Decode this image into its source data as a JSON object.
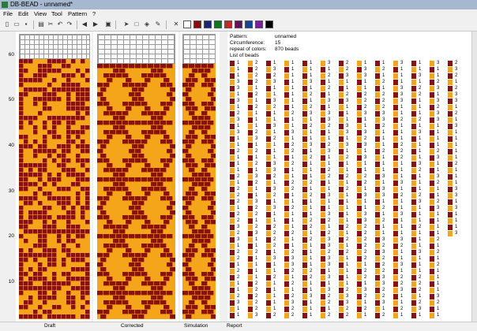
{
  "window": {
    "title": "DB-BEAD - unnamed*"
  },
  "menu": {
    "items": [
      "File",
      "Edit",
      "View",
      "Tool",
      "Pattern",
      "?"
    ]
  },
  "toolbar": {
    "icons": [
      "new-file-icon",
      "open-folder-icon",
      "save-icon",
      "print-icon",
      "cut-icon",
      "undo-icon",
      "redo-icon",
      "arrow-left-icon",
      "arrow-right-icon",
      "preview-icon",
      "pointer-icon",
      "select-rect-icon",
      "fill-bucket-icon",
      "pipette-icon",
      "clear-icon"
    ],
    "colors": [
      "#ffffff",
      "#8b0a0a",
      "#1a237e",
      "#0a7a1a",
      "#c62828",
      "#6a0d5a",
      "#0d47a1",
      "#7b1fa2",
      "#000000"
    ]
  },
  "ruler": {
    "labels": [
      "60",
      "50",
      "40",
      "30",
      "20",
      "10"
    ]
  },
  "panels": {
    "draft": "Draft",
    "corrected": "Corrected",
    "simulation": "Simulation",
    "report": "Report"
  },
  "report": {
    "pattern_label": "Pattern:",
    "pattern_value": "unnamed",
    "circumference_label": "Circumference:",
    "circumference_value": "15",
    "repeat_label": "repeat of colors:",
    "repeat_value": "870 beads",
    "list_label": "List of beads"
  },
  "colors": {
    "bead_dark": "#8b1010",
    "bead_light": "#f4a519"
  }
}
